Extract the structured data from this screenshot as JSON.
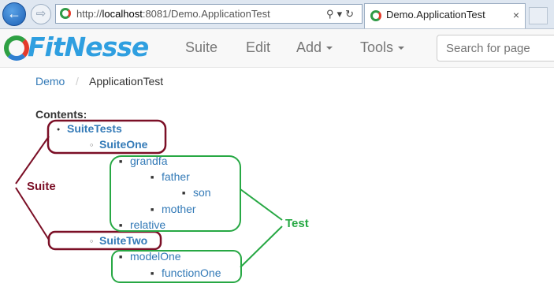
{
  "browser": {
    "url_prefix": "http://",
    "url_host": "localhost",
    "url_rest": ":8081/Demo.ApplicationTest",
    "tab_title": "Demo.ApplicationTest",
    "tab_close": "×"
  },
  "header": {
    "logo_text": "FitNesse",
    "menu": {
      "suite": "Suite",
      "edit": "Edit",
      "add": "Add",
      "tools": "Tools"
    },
    "search_placeholder": "Search for page"
  },
  "breadcrumb": {
    "parent": "Demo",
    "separator": "/",
    "current": "ApplicationTest"
  },
  "contents": {
    "title": "Contents:",
    "items": [
      {
        "label": "SuiteTests"
      },
      {
        "label": "SuiteOne"
      },
      {
        "label": "grandfa"
      },
      {
        "label": "father"
      },
      {
        "label": "son"
      },
      {
        "label": "mother"
      },
      {
        "label": "relative"
      },
      {
        "label": "SuiteTwo"
      },
      {
        "label": "modelOne"
      },
      {
        "label": "functionOne"
      }
    ]
  },
  "annotations": {
    "suite_label": "Suite",
    "test_label": "Test",
    "suite_color": "#7b0f26",
    "test_color": "#27a844"
  }
}
